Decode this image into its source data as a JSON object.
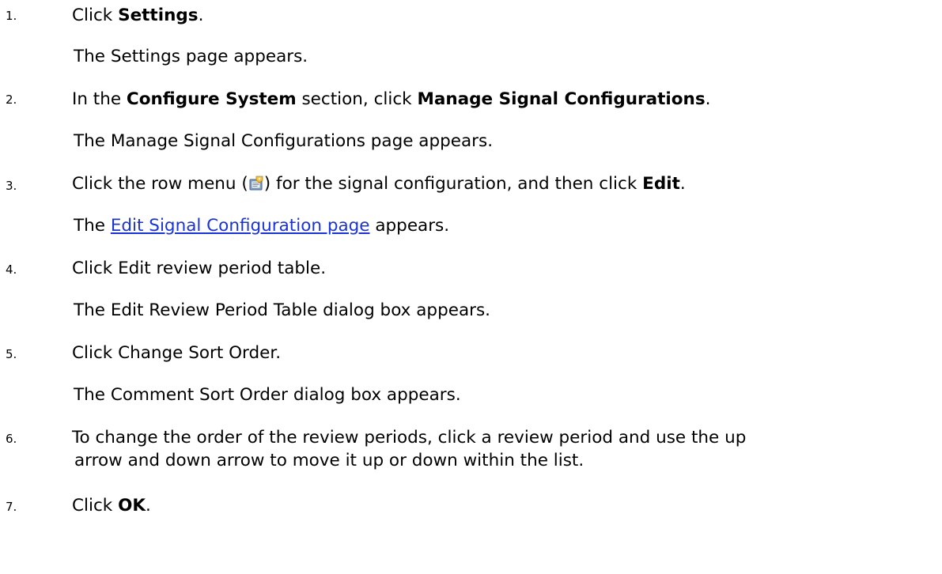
{
  "steps": [
    {
      "number": "1.",
      "pre": "Click ",
      "bold": "Settings",
      "post": ".",
      "result": "The Settings page appears."
    },
    {
      "number": "2.",
      "pre": "In the ",
      "bold1": "Configure System",
      "mid": " section, click ",
      "bold2": "Manage Signal Configurations",
      "post": ".",
      "result": "The Manage Signal Configurations page appears."
    },
    {
      "number": "3.",
      "pre": "Click the row menu (",
      "icon": "row-menu-icon",
      "mid": ") for the signal configuration, and then click ",
      "bold": "Edit",
      "post": ".",
      "result_pre": "The ",
      "result_link": "Edit Signal Configuration page",
      "result_post": " appears."
    },
    {
      "number": "4.",
      "text": "Click Edit review period table.",
      "result": "The Edit Review Period Table dialog box appears."
    },
    {
      "number": "5.",
      "text": "Click Change Sort Order.",
      "result": "The Comment Sort Order dialog box appears."
    },
    {
      "number": "6.",
      "line1": "To change the order of the review periods, click a review period and use the up",
      "line2": "arrow and down arrow to move it up or down within the list."
    },
    {
      "number": "7.",
      "pre": "Click ",
      "bold": "OK",
      "post": "."
    }
  ],
  "colors": {
    "text": "#000000",
    "link": "#1a33d6",
    "background": "#ffffff"
  }
}
